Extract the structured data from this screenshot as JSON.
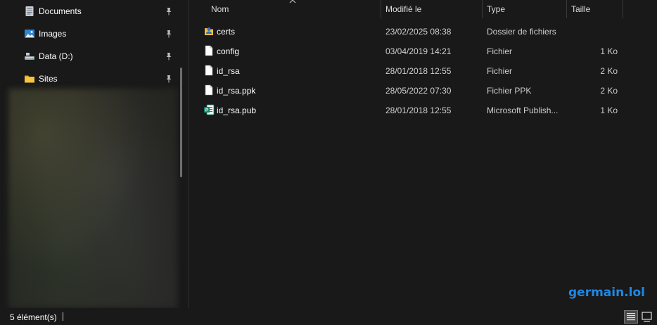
{
  "nav": {
    "items": [
      {
        "label": "Documents",
        "icon": "documents-icon",
        "pinned": true
      },
      {
        "label": "Images",
        "icon": "pictures-icon",
        "pinned": true
      },
      {
        "label": "Data (D:)",
        "icon": "drive-icon",
        "pinned": true
      },
      {
        "label": "Sites",
        "icon": "folder-icon",
        "pinned": true
      }
    ]
  },
  "columns": {
    "name": "Nom",
    "modified": "Modifié le",
    "type": "Type",
    "size": "Taille"
  },
  "files": [
    {
      "name": "certs",
      "modified": "23/02/2025 08:38",
      "type": "Dossier de fichiers",
      "size": "",
      "icon": "user-folder-icon"
    },
    {
      "name": "config",
      "modified": "03/04/2019 14:21",
      "type": "Fichier",
      "size": "1 Ko",
      "icon": "file-icon"
    },
    {
      "name": "id_rsa",
      "modified": "28/01/2018 12:55",
      "type": "Fichier",
      "size": "2 Ko",
      "icon": "file-icon"
    },
    {
      "name": "id_rsa.ppk",
      "modified": "28/05/2022 07:30",
      "type": "Fichier PPK",
      "size": "2 Ko",
      "icon": "file-icon"
    },
    {
      "name": "id_rsa.pub",
      "modified": "28/01/2018 12:55",
      "type": "Microsoft Publish...",
      "size": "1 Ko",
      "icon": "publisher-file-icon"
    }
  ],
  "status": {
    "count": "5 élément(s)"
  },
  "watermark": "germain.lol",
  "colors": {
    "background": "#191919",
    "accent": "#1e88e5",
    "folder": "#f2c04a",
    "publisher": "#0f8a6c"
  }
}
